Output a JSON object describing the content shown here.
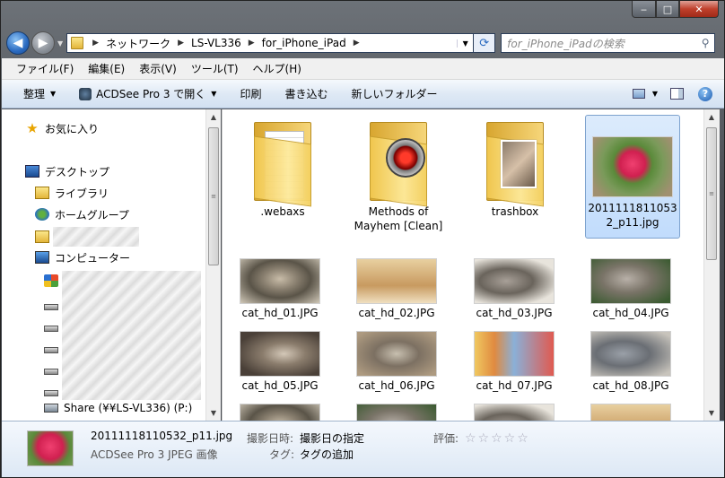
{
  "window": {
    "title": ""
  },
  "caption_buttons": {
    "minimize": "‒",
    "maximize": "□",
    "close": "✕"
  },
  "address": {
    "crumbs": [
      "ネットワーク",
      "LS-VL336",
      "for_iPhone_iPad"
    ]
  },
  "search": {
    "placeholder": "for_iPhone_iPadの検索"
  },
  "menu": [
    "ファイル(F)",
    "編集(E)",
    "表示(V)",
    "ツール(T)",
    "ヘルプ(H)"
  ],
  "toolbar": {
    "organize": "整理",
    "open_with": "ACDSee Pro 3 で開く",
    "print": "印刷",
    "burn": "書き込む",
    "new_folder": "新しいフォルダー"
  },
  "nav": {
    "favorites": "お気に入り",
    "desktop": "デスクトップ",
    "libraries": "ライブラリ",
    "homegroup": "ホームグループ",
    "computer": "コンピューター",
    "share_drive": "Share (¥¥LS-VL336) (P:)"
  },
  "items": [
    {
      "label": ".webaxs",
      "kind": "folder"
    },
    {
      "label": "Methods of Mayhem [Clean]",
      "kind": "folder"
    },
    {
      "label": "trashbox",
      "kind": "folder"
    },
    {
      "label": "20111118110532_p11.jpg",
      "kind": "image",
      "selected": true
    },
    {
      "label": "cat_hd_01.JPG"
    },
    {
      "label": "cat_hd_02.JPG"
    },
    {
      "label": "cat_hd_03.JPG"
    },
    {
      "label": "cat_hd_04.JPG"
    },
    {
      "label": "cat_hd_05.JPG"
    },
    {
      "label": "cat_hd_06.JPG"
    },
    {
      "label": "cat_hd_07.JPG"
    },
    {
      "label": "cat_hd_08.JPG"
    }
  ],
  "details": {
    "filename": "20111118110532_p11.jpg",
    "filetype": "ACDSee Pro 3 JPEG 画像",
    "date_label": "撮影日時:",
    "date_value": "撮影日の指定",
    "tags_label": "タグ:",
    "tags_value": "タグの追加",
    "rating_label": "評価:",
    "rating_stars": "☆☆☆☆☆"
  }
}
